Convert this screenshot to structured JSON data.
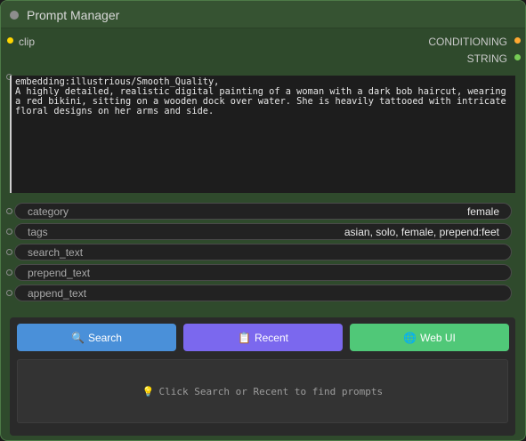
{
  "node": {
    "title": "Prompt Manager",
    "inputs": [
      {
        "label": "clip",
        "color": "#ffd500"
      }
    ],
    "outputs": [
      {
        "label": "CONDITIONING",
        "color": "#ffa931"
      },
      {
        "label": "STRING",
        "color": "#77cc55"
      }
    ]
  },
  "prompt": {
    "text": "embedding:illustrious/Smooth_Quality,\nA highly detailed, realistic digital painting of a woman with a dark bob haircut, wearing a red bikini, sitting on a wooden dock over water. She is heavily tattooed with intricate floral designs on her arms and side."
  },
  "widgets": [
    {
      "label": "category",
      "value": "female"
    },
    {
      "label": "tags",
      "value": "asian, solo, female, prepend:feet"
    },
    {
      "label": "search_text",
      "value": ""
    },
    {
      "label": "prepend_text",
      "value": ""
    },
    {
      "label": "append_text",
      "value": ""
    }
  ],
  "buttons": [
    {
      "label": "Search",
      "icon": "🔍",
      "icon_name": "magnifier-icon",
      "color": "#4a90d9"
    },
    {
      "label": "Recent",
      "icon": "📋",
      "icon_name": "clipboard-icon",
      "color": "#7b68ee"
    },
    {
      "label": "Web UI",
      "icon": "🌐",
      "icon_name": "globe-icon",
      "color": "#50c878"
    }
  ],
  "results": {
    "icon": "💡",
    "icon_name": "lightbulb-icon",
    "message": "Click Search or Recent to find prompts"
  }
}
